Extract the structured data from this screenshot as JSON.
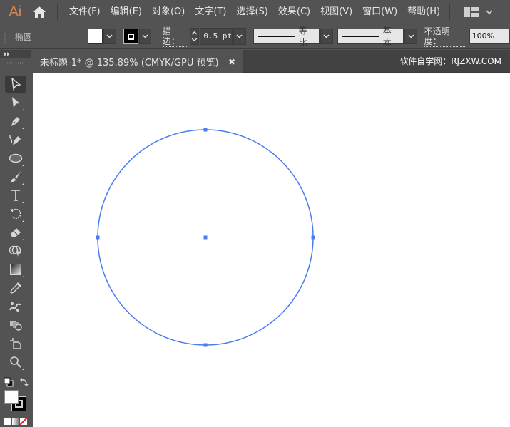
{
  "app": {
    "logo": "Ai",
    "accent_color": "#d4834a",
    "selection_color": "#4a7cf0"
  },
  "menubar": {
    "items": [
      {
        "label": "文件(F)"
      },
      {
        "label": "编辑(E)"
      },
      {
        "label": "对象(O)"
      },
      {
        "label": "文字(T)"
      },
      {
        "label": "选择(S)"
      },
      {
        "label": "效果(C)"
      },
      {
        "label": "视图(V)"
      },
      {
        "label": "窗口(W)"
      },
      {
        "label": "帮助(H)"
      }
    ],
    "home_icon": "home-icon",
    "workspace_icon": "workspace-layout-icon"
  },
  "controlbar": {
    "object_type": "椭圆",
    "fill_color": "#ffffff",
    "stroke_color": "#000000",
    "stroke_label": "描边：",
    "stroke_weight": "0.5 pt",
    "variable_width_label": "等比",
    "brush_label": "基本",
    "opacity_label": "不透明度：",
    "opacity_value": "100%"
  },
  "document": {
    "tab_title": "未标题-1* @ 135.89% (CMYK/GPU 预览)",
    "close_symbol": "✖",
    "zoom": "135.89%",
    "color_mode": "CMYK/GPU 预览",
    "watermark": "软件自学网：RJZXW.COM"
  },
  "toolbar": {
    "tools": [
      {
        "name": "selection-tool",
        "active": true
      },
      {
        "name": "direct-selection-tool"
      },
      {
        "name": "pen-tool"
      },
      {
        "name": "curvature-tool"
      },
      {
        "name": "ellipse-tool"
      },
      {
        "name": "paintbrush-tool"
      },
      {
        "name": "type-tool"
      },
      {
        "name": "rotate-tool"
      },
      {
        "name": "eraser-tool"
      },
      {
        "name": "shape-builder-tool"
      },
      {
        "name": "gradient-tool"
      },
      {
        "name": "eyedropper-tool"
      },
      {
        "name": "puppet-warp-tool"
      },
      {
        "name": "blend-tool"
      },
      {
        "name": "artboard-tool"
      },
      {
        "name": "zoom-tool"
      }
    ],
    "fill_swatch": "#ffffff",
    "stroke_swatch": "#000000"
  },
  "canvas": {
    "shape": "ellipse",
    "selected": true,
    "anchor_points": [
      "top",
      "right",
      "bottom",
      "left",
      "center"
    ]
  }
}
